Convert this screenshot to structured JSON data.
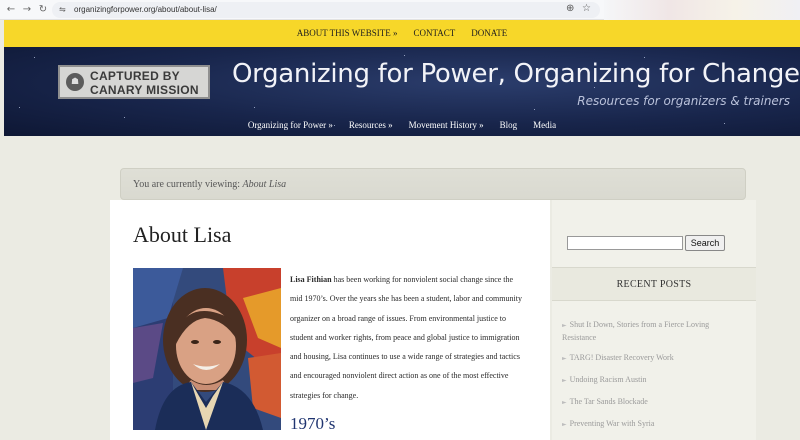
{
  "browser": {
    "url": "organizingforpower.org/about/about-lisa/",
    "back_icon": "←",
    "forward_icon": "→",
    "reload_icon": "↻",
    "site_icon": "⇋",
    "zoom_icon": "⊕",
    "star_icon": "☆"
  },
  "top_nav": {
    "items": [
      "ABOUT THIS WEBSITE »",
      "CONTACT",
      "DONATE"
    ]
  },
  "header": {
    "badge_line1": "CAPTURED BY",
    "badge_line2": "CANARY MISSION",
    "badge_icon": "☗",
    "title": "Organizing for Power, Organizing for Change",
    "tagline": "Resources for organizers & trainers",
    "colors": {
      "nav_yellow": "#f7d729",
      "banner_navy": "#18254b"
    }
  },
  "main_nav": {
    "items": [
      "Organizing for Power »",
      "Resources »",
      "Movement History »",
      "Blog",
      "Media"
    ]
  },
  "breadcrumb": {
    "prefix": "You are currently viewing:",
    "current": "About Lisa"
  },
  "content": {
    "title": "About Lisa",
    "bio_name": "Lisa Fithian",
    "bio_text": " has been working for nonviolent social change since the mid  1970’s.  Over the years she has been a student, labor and community organizer on a broad range of issues.  From environmental justice to student and worker rights, from peace and global justice to immigration and housing, Lisa continues to use a wide range of strategies and tactics and encouraged nonviolent direct action as one of the most effective strategies for change.",
    "section_heading": "1970’s"
  },
  "sidebar": {
    "search_button": "Search",
    "search_value": "",
    "recent_posts_title": "RECENT POSTS",
    "arrow_icon": "►",
    "posts": [
      "Shut It Down, Stories from a Fierce Loving Resistance",
      "TARG! Disaster Recovery Work",
      "Undoing Racism Austin",
      "The Tar Sands Blockade",
      "Preventing War with Syria"
    ]
  }
}
